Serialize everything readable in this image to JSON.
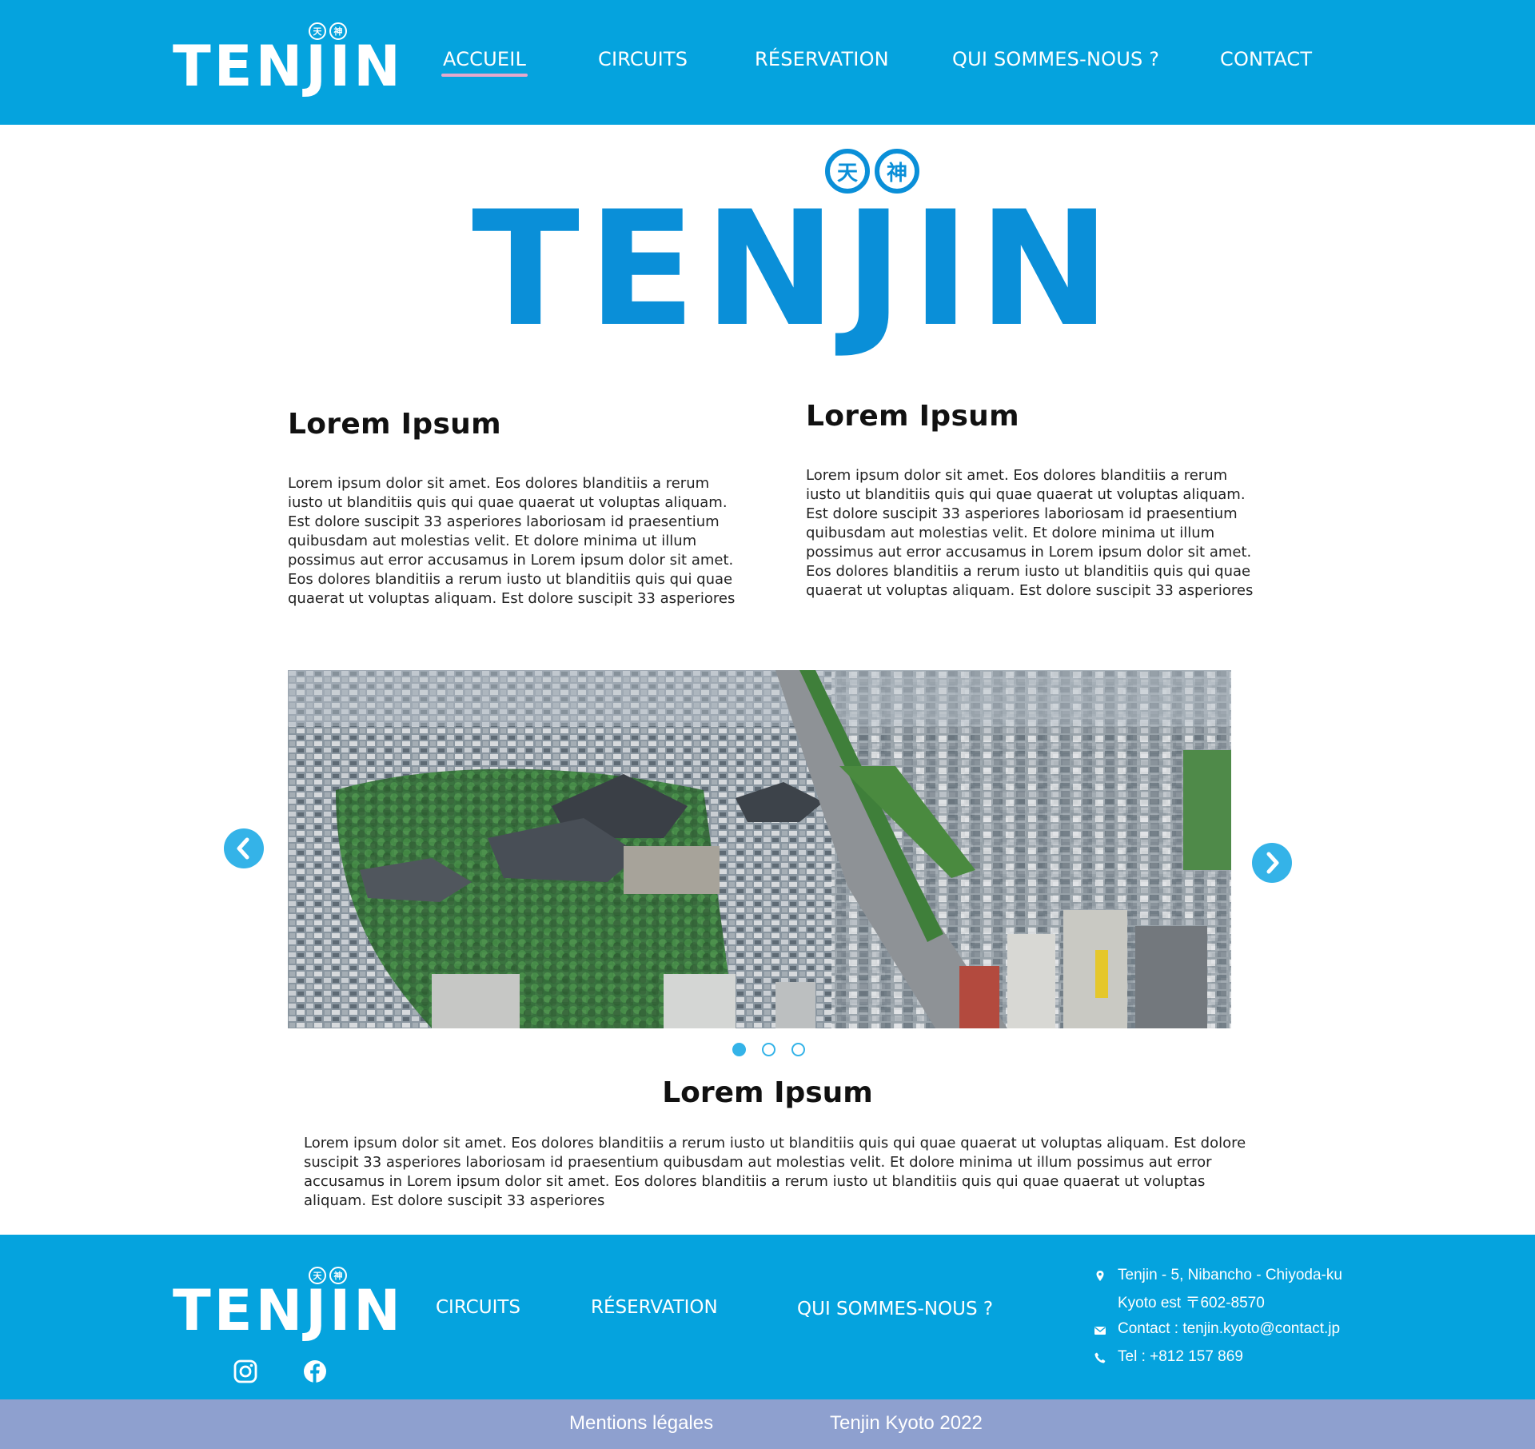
{
  "brand": {
    "name": "TENJIN",
    "kanji": [
      "天",
      "神"
    ]
  },
  "nav": {
    "items": [
      {
        "label": "ACCUEIL",
        "active": true
      },
      {
        "label": "CIRCUITS",
        "active": false
      },
      {
        "label": "RÉSERVATION",
        "active": false
      },
      {
        "label": "QUI SOMMES-NOUS ?",
        "active": false
      },
      {
        "label": "CONTACT",
        "active": false
      }
    ]
  },
  "sections": {
    "left": {
      "title": "Lorem Ipsum",
      "body": "Lorem ipsum dolor sit amet. Eos dolores blanditiis a rerum iusto ut blanditiis quis qui quae quaerat ut voluptas aliquam. Est dolore suscipit 33 asperiores laboriosam id praesentium quibusdam aut molestias velit. Et dolore minima ut illum possimus aut error accusamus in Lorem ipsum dolor sit amet. Eos dolores blanditiis a rerum iusto ut blanditiis quis qui quae quaerat ut voluptas aliquam. Est dolore suscipit 33 asperiores"
    },
    "right": {
      "title": "Lorem Ipsum",
      "body": "Lorem ipsum dolor sit amet. Eos dolores blanditiis a rerum iusto ut blanditiis quis qui quae quaerat ut voluptas aliquam. Est dolore suscipit 33 asperiores laboriosam id praesentium quibusdam aut molestias velit. Et dolore minima ut illum possimus aut error accusamus in Lorem ipsum dolor sit amet. Eos dolores blanditiis a rerum iusto ut blanditiis quis qui quae quaerat ut voluptas aliquam. Est dolore suscipit 33 asperiores"
    },
    "center": {
      "title": "Lorem Ipsum",
      "body": "Lorem ipsum dolor sit amet. Eos dolores blanditiis a rerum iusto ut blanditiis quis qui quae quaerat ut voluptas aliquam. Est dolore suscipit 33 asperiores laboriosam id praesentium quibusdam aut molestias velit. Et dolore minima ut illum possimus aut error accusamus in Lorem ipsum dolor sit amet. Eos dolores blanditiis a rerum iusto ut blanditiis quis qui quae quaerat ut voluptas aliquam. Est dolore suscipit 33 asperiores"
    }
  },
  "carousel": {
    "slide_count": 3,
    "active_slide": 1,
    "icons": {
      "prev": "chevron-left-icon",
      "next": "chevron-right-icon"
    }
  },
  "footer": {
    "links": [
      "CIRCUITS",
      "RÉSERVATION",
      "QUI SOMMES-NOUS ?"
    ],
    "social": [
      "instagram-icon",
      "facebook-icon"
    ],
    "address_line1": "Tenjin - 5, Nibancho - Chiyoda-ku",
    "address_line2": "Kyoto est 〒602-8570",
    "email": "Contact : tenjin.kyoto@contact.jp",
    "phone": "Tel : +812 157 869"
  },
  "bottom_bar": {
    "legal": "Mentions légales",
    "copyright": "Tenjin Kyoto 2022"
  },
  "colors": {
    "primary": "#05a3de",
    "logo_blue": "#0a8fd8",
    "accent_blue": "#34b3e8",
    "nav_underline": "#e6a9cc",
    "bottom_bar": "#8ea0cf"
  }
}
